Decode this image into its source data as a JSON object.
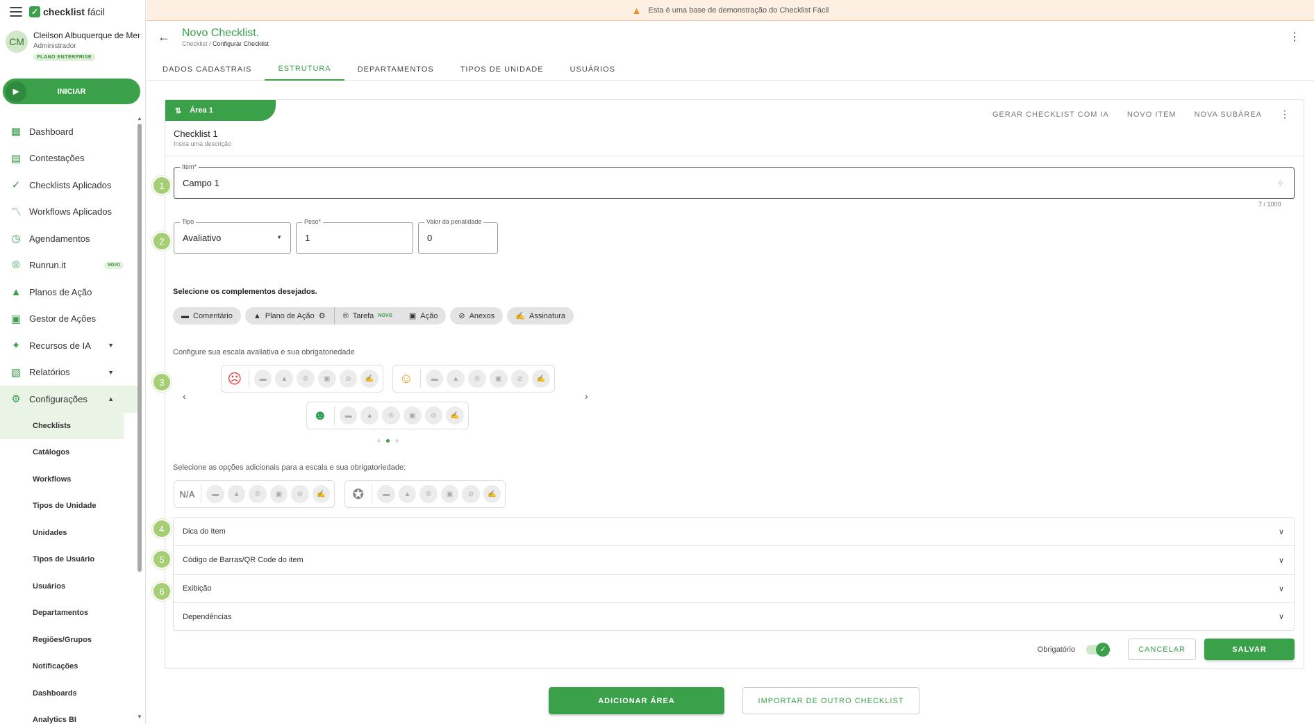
{
  "app": {
    "logo_bold": "checklist",
    "logo_light": "fácil"
  },
  "user": {
    "initials": "CM",
    "name": "Cleilson Albuquerque de Mene",
    "role": "Administrador",
    "plan": "PLANO ENTERPRISE"
  },
  "start_button": "INICIAR",
  "nav": [
    {
      "label": "Dashboard",
      "icon": "dashboard-icon"
    },
    {
      "label": "Contestações",
      "icon": "list-icon"
    },
    {
      "label": "Checklists Aplicados",
      "icon": "check-icon"
    },
    {
      "label": "Workflows Aplicados",
      "icon": "trend-icon"
    },
    {
      "label": "Agendamentos",
      "icon": "clock-icon"
    },
    {
      "label": "Runrun.it",
      "icon": "runrun-icon",
      "badge": "NOVO"
    },
    {
      "label": "Planos de Ação",
      "icon": "warning-icon"
    },
    {
      "label": "Gestor de Ações",
      "icon": "kanban-icon"
    },
    {
      "label": "Recursos de IA",
      "icon": "sparkle-icon"
    },
    {
      "label": "Relatórios",
      "icon": "report-icon"
    },
    {
      "label": "Configurações",
      "icon": "gear-icon"
    }
  ],
  "sub_nav": [
    "Checklists",
    "Catálogos",
    "Workflows",
    "Tipos de Unidade",
    "Unidades",
    "Tipos de Usuário",
    "Usuários",
    "Departamentos",
    "Regiões/Grupos",
    "Notificações",
    "Dashboards",
    "Analytics BI"
  ],
  "banner": "Esta é uma base de demonstração do Checklist Fácil",
  "header": {
    "title": "Novo Checklist.",
    "crumb_root": "Checklist /",
    "crumb_current": "Configurar Checklist"
  },
  "tabs": [
    "DADOS CADASTRAIS",
    "ESTRUTURA",
    "DEPARTAMENTOS",
    "TIPOS DE UNIDADE",
    "USUÁRIOS"
  ],
  "area": {
    "name": "Área 1",
    "actions": [
      "GERAR CHECKLIST COM IA",
      "NOVO ITEM",
      "NOVA SUBÁREA"
    ],
    "checklist_title": "Checklist 1",
    "checklist_desc": "Insira uma descrição"
  },
  "steps": [
    "1",
    "2",
    "3",
    "4",
    "5",
    "6"
  ],
  "item_field": {
    "label": "Item*",
    "value": "Campo 1",
    "counter": "7 / 1000"
  },
  "tipo_field": {
    "label": "Tipo",
    "value": "Avaliativo"
  },
  "peso_field": {
    "label": "Peso*",
    "value": "1"
  },
  "penalty_field": {
    "label": "Valor da penalidade",
    "value": "0"
  },
  "complements": {
    "title": "Selecione os complementos desejados.",
    "chips": [
      "Comentário",
      "Plano de Ação",
      "Tarefa",
      "Ação",
      "Anexos",
      "Assinatura"
    ],
    "novo": "NOVO"
  },
  "scale": {
    "title": "Configure sua escala avaliativa e sua obrigatoriedade"
  },
  "extra": {
    "title": "Selecione as opções adicionais para a escala e sua obrigatoriedade:",
    "na": "N/A"
  },
  "accordions": [
    "Dica do Item",
    "Código de Barras/QR Code do item",
    "Exibição",
    "Dependências"
  ],
  "footer": {
    "required_label": "Obrigatório",
    "cancel": "CANCELAR",
    "save": "SALVAR"
  },
  "bottom": {
    "add_area": "ADICIONAR ÁREA",
    "import": "IMPORTAR DE OUTRO CHECKLIST"
  },
  "colors": {
    "accent": "#3aa04a",
    "step": "#a6cf75",
    "banner": "#fdf0e2",
    "sad": "#e53935",
    "neutral": "#f0a020",
    "happy": "#2e9e55"
  }
}
